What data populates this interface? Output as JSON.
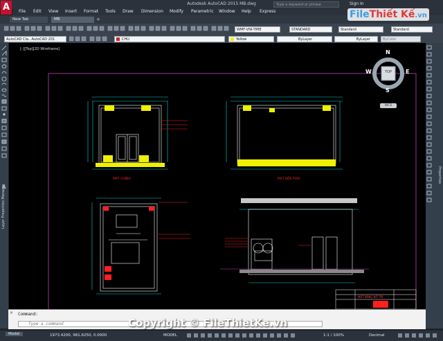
{
  "app": {
    "title": "Autodesk AutoCAD 2015    MB.dwg",
    "search_placeholder": "Type a keyword or phrase",
    "sign_in": "Sign In"
  },
  "menu": [
    "File",
    "Edit",
    "View",
    "Insert",
    "Format",
    "Tools",
    "Draw",
    "Dimension",
    "Modify",
    "Parametric",
    "Window",
    "Help",
    "Express"
  ],
  "tabs": [
    "New Tab",
    "MB"
  ],
  "ribbon": {
    "workspace": "AutoCAD Cla...AutoCAD 201",
    "layer": "CHU",
    "color": "Yellow",
    "linetype": "ByLayer",
    "lineweight": "ByLayer",
    "plotstyle": "ByColor",
    "text_style": "WMF-VNI-TIME",
    "dim_style": "STANDARD",
    "table_style": "Standard",
    "mleader_style": "Standard"
  },
  "viewport": {
    "label": "[–][Top][2D Wireframe]"
  },
  "viewcube": {
    "top": "TOP",
    "n": "N",
    "s": "S",
    "e": "E",
    "w": "W",
    "wcs": "WCS"
  },
  "drawing": {
    "label_front": "MẶT CHÍNH",
    "label_side": "MẶT BÊN PHẢI",
    "title_block": "MẶT BẰNG BỐ TRÍ"
  },
  "side_panels": {
    "left": "Layer Properties Manager",
    "right": "Properties"
  },
  "command": {
    "label": "Command:",
    "placeholder": "Type a command"
  },
  "status": {
    "model": "Model",
    "coords": "1973.4200, 981.6250, 0.0000",
    "model_btn": "MODEL",
    "scale": "1:1 / 100%",
    "units": "Decimal"
  },
  "watermark": {
    "text": "Copyright © FileThietKe.vn",
    "logo_a": "File",
    "logo_b": "Thiết Kế",
    "logo_c": ".vn"
  },
  "colors": {
    "background": "#000000",
    "drawing_frame": "#d33bd3",
    "walls": "#ffffff",
    "accent_yellow": "#f0f000",
    "accent_red": "#ff2020",
    "dims": "#00d8d8"
  }
}
